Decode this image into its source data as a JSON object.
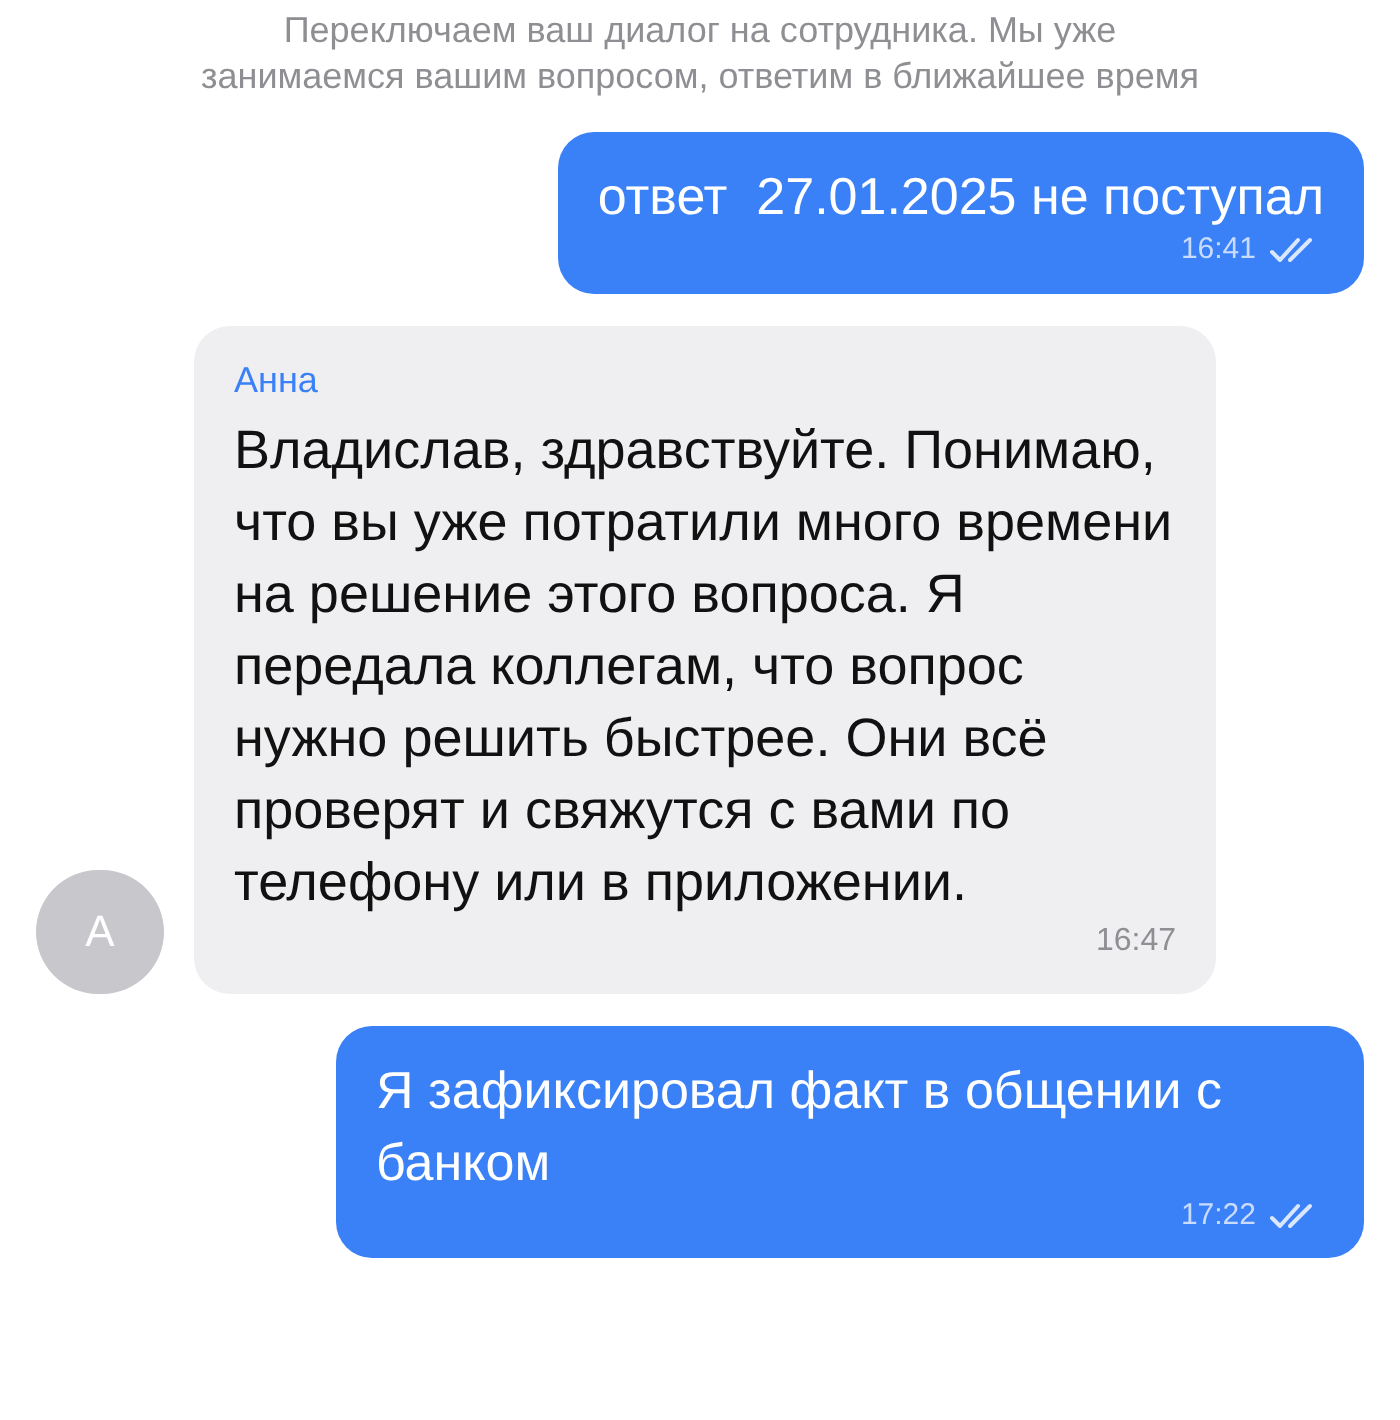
{
  "messages": [
    {
      "kind": "system",
      "text": "Переключаем ваш диалог на сотрудника. Мы уже занимаемся вашим вопросом, ответим в ближайшее время"
    },
    {
      "kind": "outgoing",
      "text": "ответ  27.01.2025 не поступал",
      "time": "16:41",
      "read": true
    },
    {
      "kind": "incoming",
      "author": "Анна",
      "avatar": "А",
      "text": "Владислав, здравствуйте. Понимаю, что вы уже потратили много времени на решение этого вопроса. Я передала коллегам, что вопрос нужно решить быстрее. Они всё проверят и свяжутся с вами по телефону или в приложении.",
      "time": "16:47"
    },
    {
      "kind": "outgoing",
      "text": "Я зафиксировал факт в общении с банком",
      "time": "17:22",
      "read": true
    }
  ]
}
